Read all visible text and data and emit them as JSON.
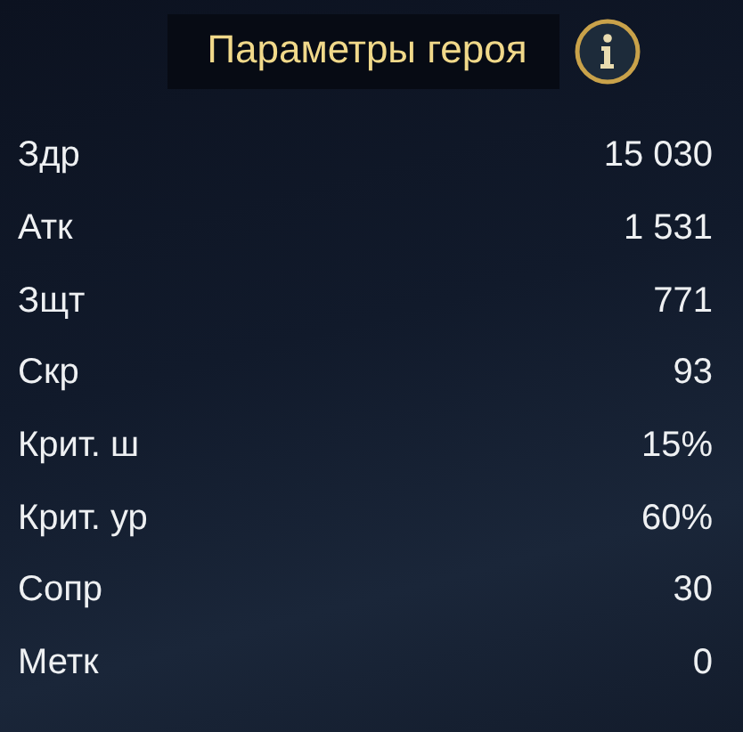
{
  "header": {
    "title": "Параметры героя"
  },
  "stats": [
    {
      "label": "Здр",
      "value": "15 030"
    },
    {
      "label": "Атк",
      "value": "1 531"
    },
    {
      "label": "Зщт",
      "value": "771"
    },
    {
      "label": "Скр",
      "value": "93"
    },
    {
      "label": "Крит. ш",
      "value": "15%"
    },
    {
      "label": "Крит. ур",
      "value": "60%"
    },
    {
      "label": "Сопр",
      "value": "30"
    },
    {
      "label": "Метк",
      "value": "0"
    }
  ]
}
